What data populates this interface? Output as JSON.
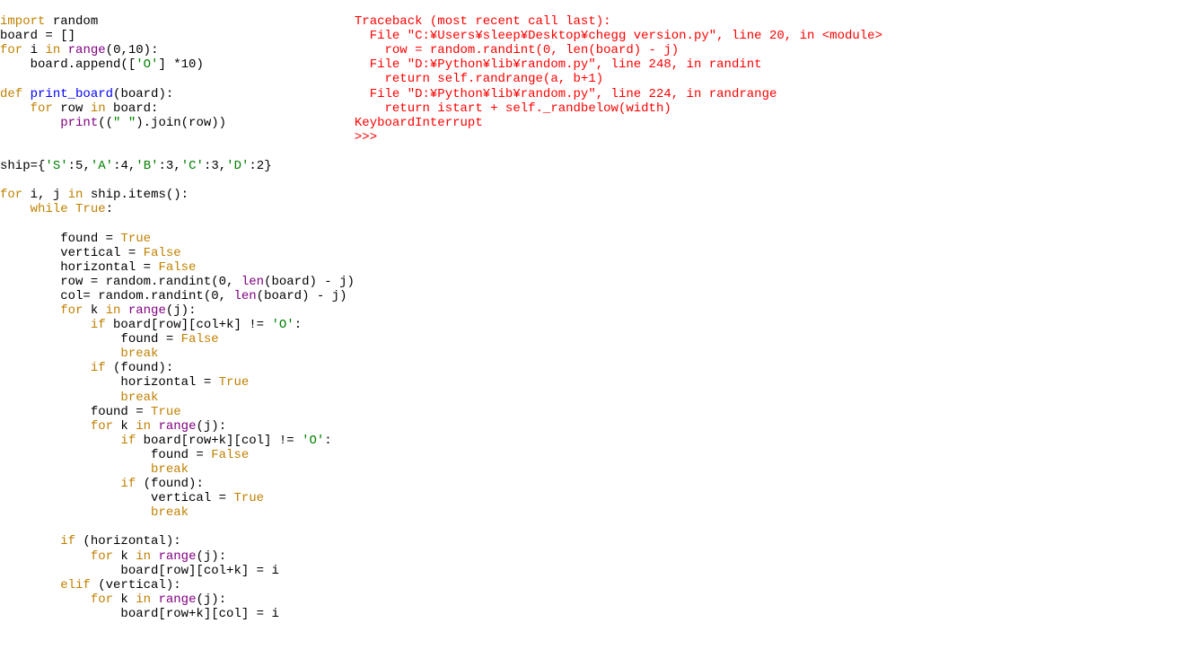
{
  "code": {
    "l1_import": "import",
    "l1_random": " random",
    "l2": "board = []",
    "l3_for": "for",
    "l3_i": " i ",
    "l3_in": "in",
    "l3_range": " range",
    "l3_args": "(0,10):",
    "l4_a": "    board.append([",
    "l4_str": "'O'",
    "l4_b": "] *10)",
    "blank": "",
    "l6_def": "def",
    "l6_name": " print_board",
    "l6_args": "(board):",
    "l7_for": "    for",
    "l7_row": " row ",
    "l7_in": "in",
    "l7_b": " board:",
    "l8_a": "        print",
    "l8_b": "((",
    "l8_str": "\" \"",
    "l8_c": ").join(row))",
    "l11_a": "ship={",
    "l11_s": "'S'",
    "l11_s2": ":5,",
    "l11_a1": "'A'",
    "l11_a2": ":4,",
    "l11_b1": "'B'",
    "l11_b2": ":3,",
    "l11_c1": "'C'",
    "l11_c2": ":3,",
    "l11_d1": "'D'",
    "l11_d2": ":2}",
    "l13_for": "for",
    "l13_ij": " i, j ",
    "l13_in": "in",
    "l13_rest": " ship.items():",
    "l14_while": "    while",
    "l14_true": " True",
    "l14_colon": ":",
    "l16_a": "        found = ",
    "l16_true": "True",
    "l17_a": "        vertical = ",
    "l17_false": "False",
    "l18_a": "        horizontal = ",
    "l18_false": "False",
    "l19_a": "        row = random.randint(0, ",
    "l19_len": "len",
    "l19_b": "(board) - j)",
    "l20_a": "        col= random.randint(0, ",
    "l20_len": "len",
    "l20_b": "(board) - j)",
    "l21_for": "        for",
    "l21_k": " k ",
    "l21_in": "in",
    "l21_range": " range",
    "l21_args": "(j):",
    "l22_if": "            if",
    "l22_a": " board[row][col+k] != ",
    "l22_str": "'O'",
    "l22_b": ":",
    "l23_a": "                found = ",
    "l23_false": "False",
    "l24_break": "                break",
    "l25_if": "            if",
    "l25_a": " (found):",
    "l26_a": "                horizontal = ",
    "l26_true": "True",
    "l27_break": "                break",
    "l28_a": "            found = ",
    "l28_true": "True",
    "l29_for": "            for",
    "l29_k": " k ",
    "l29_in": "in",
    "l29_range": " range",
    "l29_args": "(j):",
    "l30_if": "                if",
    "l30_a": " board[row+k][col] != ",
    "l30_str": "'O'",
    "l30_b": ":",
    "l31_a": "                    found = ",
    "l31_false": "False",
    "l32_break": "                    break",
    "l33_if": "                if",
    "l33_a": " (found):",
    "l34_a": "                    vertical = ",
    "l34_true": "True",
    "l35_break": "                    break",
    "l37_if": "        if",
    "l37_a": " (horizontal):",
    "l38_for": "            for",
    "l38_k": " k ",
    "l38_in": "in",
    "l38_range": " range",
    "l38_args": "(j):",
    "l39": "                board[row][col+k] = i",
    "l40_elif": "        elif",
    "l40_a": " (vertical):",
    "l41_for": "            for",
    "l41_k": " k ",
    "l41_in": "in",
    "l41_range": " range",
    "l41_args": "(j):",
    "l42": "                board[row+k][col] = i"
  },
  "output": {
    "o1": "Traceback (most recent call last):",
    "o2": "  File \"C:¥Users¥sleep¥Desktop¥chegg version.py\", line 20, in <module>",
    "o3": "    row = random.randint(0, len(board) - j)",
    "o4": "  File \"D:¥Python¥lib¥random.py\", line 248, in randint",
    "o5": "    return self.randrange(a, b+1)",
    "o6": "  File \"D:¥Python¥lib¥random.py\", line 224, in randrange",
    "o7": "    return istart + self._randbelow(width)",
    "o8": "KeyboardInterrupt",
    "o9": ">>> "
  }
}
